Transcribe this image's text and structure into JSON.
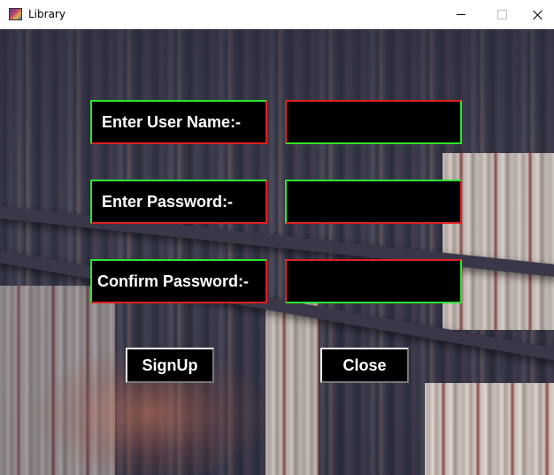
{
  "window": {
    "title": "Library",
    "icon": "library-app-icon",
    "controls": [
      "minimize-icon",
      "maximize-icon",
      "close-icon"
    ]
  },
  "form": {
    "username_label": "Enter User Name:-",
    "password_label": "Enter Password:-",
    "confirm_label": "Confirm Password:-",
    "username_value": "",
    "password_value": "",
    "confirm_value": ""
  },
  "buttons": {
    "signup_label": "SignUp",
    "close_label": "Close"
  },
  "colors": {
    "field_background": "#000000",
    "accent_green": "#2ee62e",
    "accent_red": "#e02020",
    "text": "#ffffff"
  }
}
